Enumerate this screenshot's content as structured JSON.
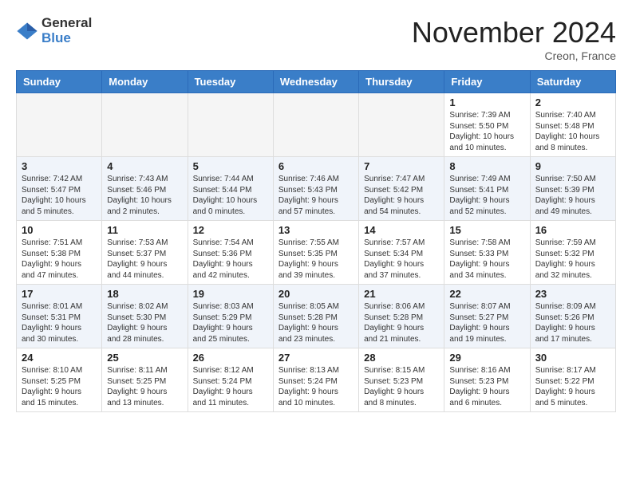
{
  "logo": {
    "general": "General",
    "blue": "Blue"
  },
  "header": {
    "month": "November 2024",
    "location": "Creon, France"
  },
  "weekdays": [
    "Sunday",
    "Monday",
    "Tuesday",
    "Wednesday",
    "Thursday",
    "Friday",
    "Saturday"
  ],
  "weeks": [
    [
      {
        "day": "",
        "text": ""
      },
      {
        "day": "",
        "text": ""
      },
      {
        "day": "",
        "text": ""
      },
      {
        "day": "",
        "text": ""
      },
      {
        "day": "",
        "text": ""
      },
      {
        "day": "1",
        "text": "Sunrise: 7:39 AM\nSunset: 5:50 PM\nDaylight: 10 hours and 10 minutes."
      },
      {
        "day": "2",
        "text": "Sunrise: 7:40 AM\nSunset: 5:48 PM\nDaylight: 10 hours and 8 minutes."
      }
    ],
    [
      {
        "day": "3",
        "text": "Sunrise: 7:42 AM\nSunset: 5:47 PM\nDaylight: 10 hours and 5 minutes."
      },
      {
        "day": "4",
        "text": "Sunrise: 7:43 AM\nSunset: 5:46 PM\nDaylight: 10 hours and 2 minutes."
      },
      {
        "day": "5",
        "text": "Sunrise: 7:44 AM\nSunset: 5:44 PM\nDaylight: 10 hours and 0 minutes."
      },
      {
        "day": "6",
        "text": "Sunrise: 7:46 AM\nSunset: 5:43 PM\nDaylight: 9 hours and 57 minutes."
      },
      {
        "day": "7",
        "text": "Sunrise: 7:47 AM\nSunset: 5:42 PM\nDaylight: 9 hours and 54 minutes."
      },
      {
        "day": "8",
        "text": "Sunrise: 7:49 AM\nSunset: 5:41 PM\nDaylight: 9 hours and 52 minutes."
      },
      {
        "day": "9",
        "text": "Sunrise: 7:50 AM\nSunset: 5:39 PM\nDaylight: 9 hours and 49 minutes."
      }
    ],
    [
      {
        "day": "10",
        "text": "Sunrise: 7:51 AM\nSunset: 5:38 PM\nDaylight: 9 hours and 47 minutes."
      },
      {
        "day": "11",
        "text": "Sunrise: 7:53 AM\nSunset: 5:37 PM\nDaylight: 9 hours and 44 minutes."
      },
      {
        "day": "12",
        "text": "Sunrise: 7:54 AM\nSunset: 5:36 PM\nDaylight: 9 hours and 42 minutes."
      },
      {
        "day": "13",
        "text": "Sunrise: 7:55 AM\nSunset: 5:35 PM\nDaylight: 9 hours and 39 minutes."
      },
      {
        "day": "14",
        "text": "Sunrise: 7:57 AM\nSunset: 5:34 PM\nDaylight: 9 hours and 37 minutes."
      },
      {
        "day": "15",
        "text": "Sunrise: 7:58 AM\nSunset: 5:33 PM\nDaylight: 9 hours and 34 minutes."
      },
      {
        "day": "16",
        "text": "Sunrise: 7:59 AM\nSunset: 5:32 PM\nDaylight: 9 hours and 32 minutes."
      }
    ],
    [
      {
        "day": "17",
        "text": "Sunrise: 8:01 AM\nSunset: 5:31 PM\nDaylight: 9 hours and 30 minutes."
      },
      {
        "day": "18",
        "text": "Sunrise: 8:02 AM\nSunset: 5:30 PM\nDaylight: 9 hours and 28 minutes."
      },
      {
        "day": "19",
        "text": "Sunrise: 8:03 AM\nSunset: 5:29 PM\nDaylight: 9 hours and 25 minutes."
      },
      {
        "day": "20",
        "text": "Sunrise: 8:05 AM\nSunset: 5:28 PM\nDaylight: 9 hours and 23 minutes."
      },
      {
        "day": "21",
        "text": "Sunrise: 8:06 AM\nSunset: 5:28 PM\nDaylight: 9 hours and 21 minutes."
      },
      {
        "day": "22",
        "text": "Sunrise: 8:07 AM\nSunset: 5:27 PM\nDaylight: 9 hours and 19 minutes."
      },
      {
        "day": "23",
        "text": "Sunrise: 8:09 AM\nSunset: 5:26 PM\nDaylight: 9 hours and 17 minutes."
      }
    ],
    [
      {
        "day": "24",
        "text": "Sunrise: 8:10 AM\nSunset: 5:25 PM\nDaylight: 9 hours and 15 minutes."
      },
      {
        "day": "25",
        "text": "Sunrise: 8:11 AM\nSunset: 5:25 PM\nDaylight: 9 hours and 13 minutes."
      },
      {
        "day": "26",
        "text": "Sunrise: 8:12 AM\nSunset: 5:24 PM\nDaylight: 9 hours and 11 minutes."
      },
      {
        "day": "27",
        "text": "Sunrise: 8:13 AM\nSunset: 5:24 PM\nDaylight: 9 hours and 10 minutes."
      },
      {
        "day": "28",
        "text": "Sunrise: 8:15 AM\nSunset: 5:23 PM\nDaylight: 9 hours and 8 minutes."
      },
      {
        "day": "29",
        "text": "Sunrise: 8:16 AM\nSunset: 5:23 PM\nDaylight: 9 hours and 6 minutes."
      },
      {
        "day": "30",
        "text": "Sunrise: 8:17 AM\nSunset: 5:22 PM\nDaylight: 9 hours and 5 minutes."
      }
    ]
  ]
}
